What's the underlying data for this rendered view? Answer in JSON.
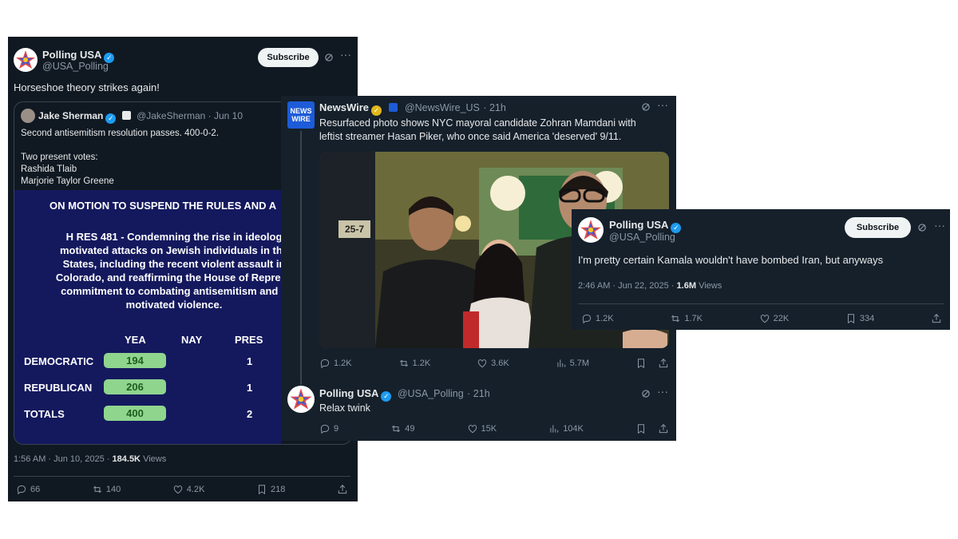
{
  "tweet1": {
    "name": "Polling USA",
    "handle": "@USA_Polling",
    "subscribe": "Subscribe",
    "text": "Horseshoe theory strikes again!",
    "quote": {
      "name": "Jake Sherman",
      "handle": "@JakeSherman",
      "time": "· Jun 10",
      "line1": "Second antisemitism resolution passes. 400-0-2.",
      "line2": "Two present votes:",
      "line3": "Rashida Tlaib",
      "line4": "Marjorie Taylor Greene",
      "vote": {
        "heading": "ON MOTION TO SUSPEND THE RULES AND A",
        "res_lines": [
          "H RES 481 - Condemning the rise in ideolog",
          "motivated attacks on Jewish individuals in the",
          "States, including the recent violent assault in",
          "Colorado, and reaffirming the House of Represe",
          "commitment to combating antisemitism and p",
          "motivated violence."
        ],
        "columns": [
          "YEA",
          "NAY",
          "PRES"
        ],
        "rows": [
          {
            "label": "DEMOCRATIC",
            "yea": "194",
            "nay": "",
            "pres": "1"
          },
          {
            "label": "REPUBLICAN",
            "yea": "206",
            "nay": "",
            "pres": "1"
          },
          {
            "label": "TOTALS",
            "yea": "400",
            "nay": "",
            "pres": "2"
          }
        ]
      }
    },
    "time": "1:56 AM · Jun 10, 2025 ·",
    "views_count": "184.5K",
    "views_label": "Views",
    "replies": "66",
    "reposts": "140",
    "likes": "4.2K",
    "bookmarks": "218"
  },
  "tweet2": {
    "name": "NewsWire",
    "handle": "@NewsWire_US",
    "time": "· 21h",
    "logo_line1": "NEWS",
    "logo_line2": "WIRE",
    "text_line1": "Resurfaced photo shows NYC mayoral candidate Zohran Mamdani with",
    "text_line2": "leftist streamer Hasan Piker, who once said America 'deserved' 9/11.",
    "photo_sign": "25-7",
    "replies": "1.2K",
    "reposts": "1.2K",
    "likes": "3.6K",
    "views": "5.7M",
    "reply": {
      "name": "Polling USA",
      "handle": "@USA_Polling",
      "time": "· 21h",
      "text": "Relax twink",
      "replies": "9",
      "reposts": "49",
      "likes": "15K",
      "views": "104K"
    }
  },
  "tweet3": {
    "name": "Polling USA",
    "handle": "@USA_Polling",
    "subscribe": "Subscribe",
    "text": "I'm pretty certain Kamala wouldn't have bombed Iran, but anyways",
    "time": "2:46 AM · Jun 22, 2025 ·",
    "views_count": "1.6M",
    "views_label": "Views",
    "replies": "1.2K",
    "reposts": "1.7K",
    "likes": "22K",
    "bookmarks": "334"
  }
}
